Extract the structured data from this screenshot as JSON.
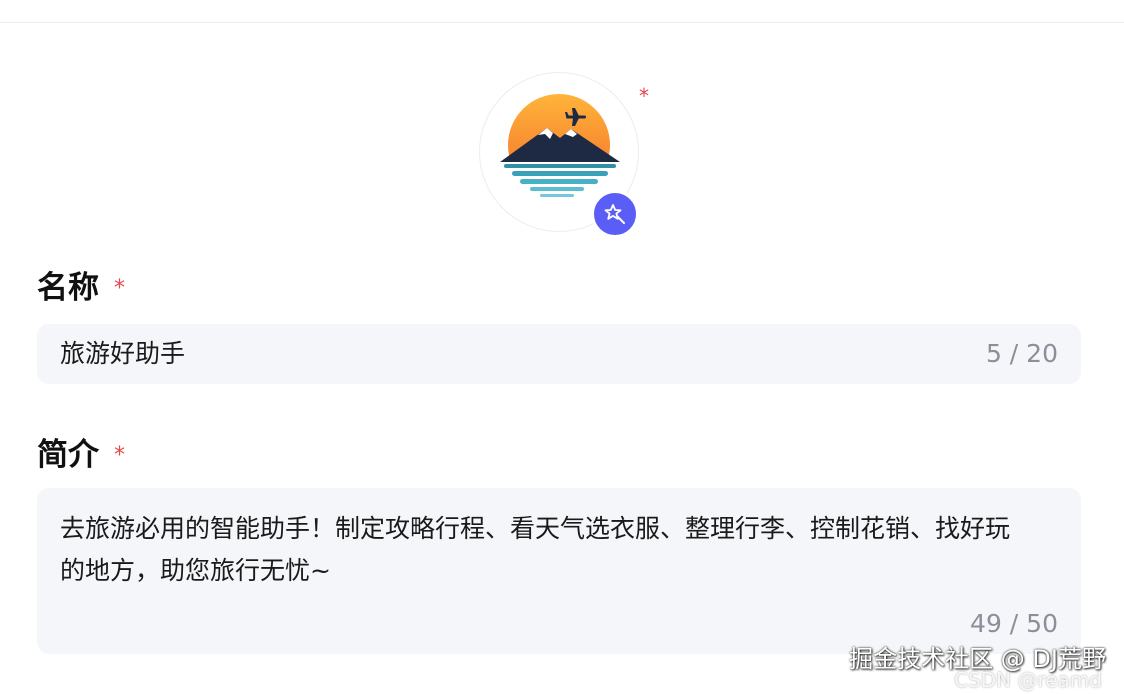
{
  "avatar": {
    "required_mark": "*",
    "magic_icon": "magic-wand-icon",
    "accent_color": "#5b5ef6"
  },
  "name_field": {
    "label": "名称",
    "required_mark": "*",
    "value": "旅游好助手",
    "counter": "5 / 20"
  },
  "description_field": {
    "label": "简介",
    "required_mark": "*",
    "value": "去旅游必用的智能助手！制定攻略行程、看天气选衣服、整理行李、控制花销、找好玩的地方，助您旅行无忧~",
    "counter": "49 / 50"
  },
  "watermark": {
    "line1": "掘金技术社区 @ DJ荒野",
    "line2": "CSDN @reamd"
  },
  "colors": {
    "required": "#e5484d",
    "input_bg": "#f5f6fa",
    "counter": "#8a8f99"
  }
}
